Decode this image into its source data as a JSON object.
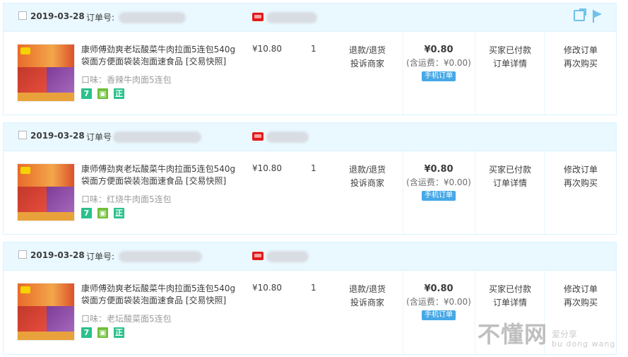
{
  "orders": [
    {
      "date": "2019-03-28",
      "order_no_label": "订单号:",
      "product_title": "康师傅劲爽老坛酸菜牛肉拉面5连包540g袋面方便面袋装泡面速食品 [交易快照]",
      "flavor": "口味：香辣牛肉面5连包",
      "price": "¥10.80",
      "qty": "1",
      "after_sale": [
        "退款/退货",
        "投诉商家"
      ],
      "pay_amount": "¥0.80",
      "pay_shipping": "(含运费：¥0.00)",
      "mobile_tag": "手机订单",
      "status": [
        "买家已付款",
        "订单详情"
      ],
      "ops": [
        "修改订单",
        "再次购买"
      ]
    },
    {
      "date": "2019-03-28",
      "order_no_label": "订单号",
      "product_title": "康师傅劲爽老坛酸菜牛肉拉面5连包540g袋面方便面袋装泡面速食品 [交易快照]",
      "flavor": "口味：红烧牛肉面5连包",
      "price": "¥10.80",
      "qty": "1",
      "after_sale": [
        "退款/退货",
        "投诉商家"
      ],
      "pay_amount": "¥0.80",
      "pay_shipping": "(含运费：¥0.00)",
      "mobile_tag": "手机订单",
      "status": [
        "买家已付款",
        "订单详情"
      ],
      "ops": [
        "修改订单",
        "再次购买"
      ]
    },
    {
      "date": "2019-03-28",
      "order_no_label": "订单号:",
      "product_title": "康师傅劲爽老坛酸菜牛肉拉面5连包540g袋面方便面袋装泡面速食品 [交易快照]",
      "flavor": "口味：老坛酸菜面5连包",
      "price": "¥10.80",
      "qty": "1",
      "after_sale": [
        "退款/退货",
        "投诉商家"
      ],
      "pay_amount": "¥0.80",
      "pay_shipping": "(含运费：¥0.00)",
      "mobile_tag": "手机订单",
      "status": [
        "买家已付款",
        "订单详情"
      ],
      "ops": [
        "修改订单",
        "再次购买"
      ]
    }
  ],
  "badges": [
    "7",
    "",
    "正"
  ],
  "watermark": {
    "big": "不懂网",
    "small1": "爱分享",
    "small2": "bu dong wang"
  },
  "colors": {
    "header_bg": "#eaf8ff",
    "border": "#daf3ff",
    "badge": "#29c08b",
    "mobile_tag": "#46a8e6"
  }
}
